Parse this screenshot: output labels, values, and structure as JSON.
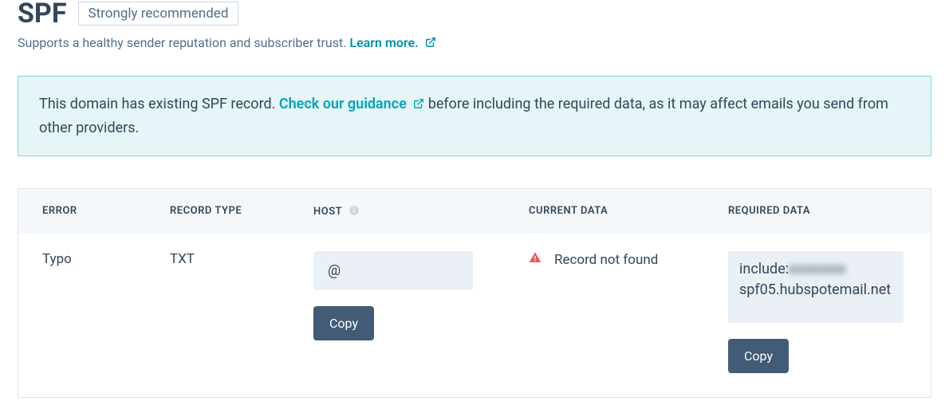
{
  "header": {
    "title": "SPF",
    "badge": "Strongly recommended",
    "subtitle_pre": "Supports a healthy sender reputation and subscriber trust. ",
    "learn_more": "Learn more."
  },
  "alert": {
    "text_pre": "This domain has existing SPF record. ",
    "link": "Check our guidance",
    "text_post": " before including the required data, as it may affect emails you send from other providers."
  },
  "table": {
    "headers": {
      "error": "ERROR",
      "record_type": "RECORD TYPE",
      "host": "HOST",
      "current_data": "CURRENT DATA",
      "required_data": "REQUIRED DATA"
    },
    "row": {
      "error": "Typo",
      "record_type": "TXT",
      "host_value": "@",
      "host_copy": "Copy",
      "current_data": "Record not found",
      "required_prefix": "include:",
      "required_blurred": "xxxxxxxx",
      "required_rest": "spf05.hubspotemail.net",
      "required_copy": "Copy"
    }
  }
}
